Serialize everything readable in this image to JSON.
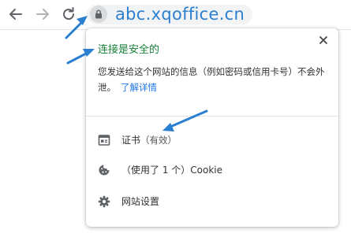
{
  "browser": {
    "url": "abc.xqoffice.cn",
    "back_icon": "arrow-left-icon",
    "forward_icon": "arrow-right-icon",
    "reload_icon": "reload-icon",
    "site_info_icon": "lock-icon"
  },
  "site_info_popup": {
    "title": "连接是安全的",
    "description": "您发送给这个网站的信息（例如密码或信用卡号）不会外泄。",
    "learn_more_link": "了解详情",
    "close_icon": "close-icon",
    "items": [
      {
        "icon": "certificate-icon",
        "label": "证书",
        "sublabel": "（有效）"
      },
      {
        "icon": "cookie-icon",
        "label": "（使用了 1 个）Cookie"
      },
      {
        "icon": "gear-icon",
        "label": "网站设置"
      }
    ]
  },
  "colors": {
    "secure_green": "#188038",
    "link_blue": "#1a73e8",
    "annotation_blue": "#2b7fd1"
  }
}
